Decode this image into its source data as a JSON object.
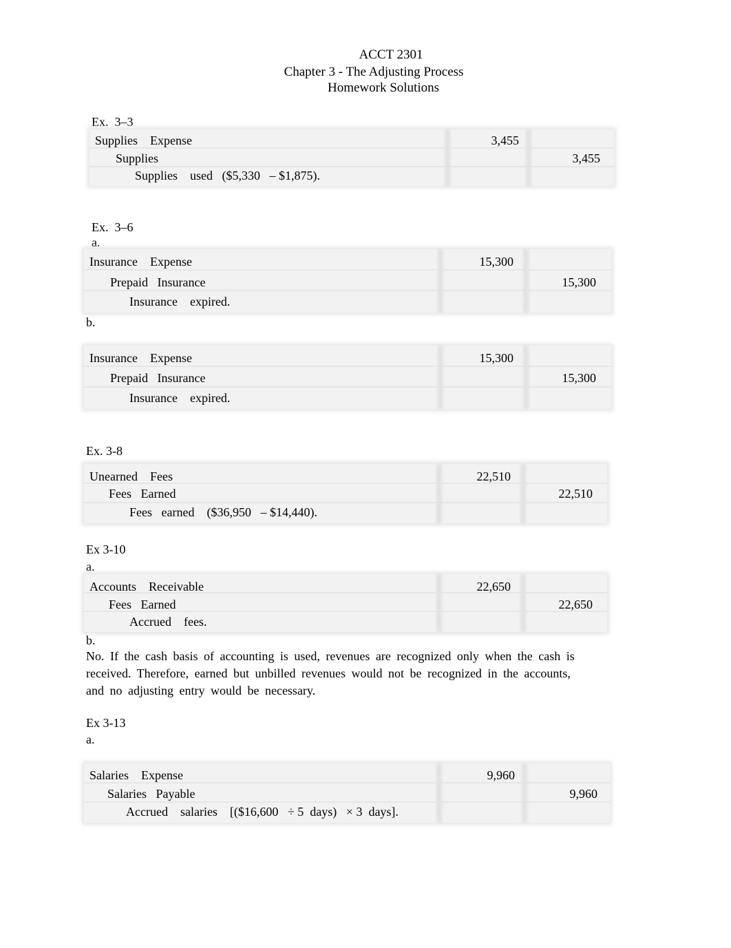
{
  "header": {
    "course": "ACCT 2301",
    "chapter": "Chapter 3 - The Adjusting Process",
    "subtitle": "Homework Solutions"
  },
  "sections": [
    {
      "title": "Ex.  3–3",
      "parts": [
        {
          "label": "",
          "entry": {
            "debit_account": "Supplies    Expense",
            "credit_account": "Supplies",
            "explanation": "Supplies    used   ($5,330   – $1,875).",
            "debit_amount": "3,455",
            "credit_amount": "3,455"
          }
        }
      ]
    },
    {
      "title": "Ex.  3–6",
      "parts": [
        {
          "label": "a.",
          "entry": {
            "debit_account": "Insurance    Expense",
            "credit_account": "Prepaid   Insurance",
            "explanation": "Insurance    expired.",
            "debit_amount": "15,300",
            "credit_amount": "15,300"
          }
        },
        {
          "label": "b.",
          "entry": {
            "debit_account": "Insurance    Expense",
            "credit_account": "Prepaid   Insurance",
            "explanation": "Insurance    expired.",
            "debit_amount": "15,300",
            "credit_amount": "15,300"
          }
        }
      ]
    },
    {
      "title": "Ex. 3-8",
      "parts": [
        {
          "label": "",
          "entry": {
            "debit_account": "Unearned    Fees",
            "credit_account": "Fees   Earned",
            "explanation": "Fees   earned    ($36,950   – $14,440).",
            "debit_amount": "22,510",
            "credit_amount": "22,510"
          }
        }
      ]
    },
    {
      "title": "Ex 3-10",
      "parts": [
        {
          "label": "a.",
          "entry": {
            "debit_account": "Accounts    Receivable",
            "credit_account": "Fees   Earned",
            "explanation": "Accrued    fees.",
            "debit_amount": "22,650",
            "credit_amount": "22,650"
          }
        },
        {
          "label": "b.",
          "text": "No.  If the  cash   basis   of accounting   is used,  revenues   are  recognized   only when  the  cash   is  received.  Therefore,  earned  but  unbilled  revenues   would  not be  recognized   in  the  accounts,   and  no  adjusting   entry  would  be  necessary."
        }
      ]
    },
    {
      "title": "Ex 3-13",
      "parts": [
        {
          "label": "a.",
          "entry": {
            "debit_account": "Salaries    Expense",
            "credit_account": "Salaries   Payable",
            "explanation": "Accrued    salaries    [($16,600   ÷ 5  days)   × 3  days].",
            "debit_amount": "9,960",
            "credit_amount": "9,960"
          }
        }
      ]
    }
  ]
}
